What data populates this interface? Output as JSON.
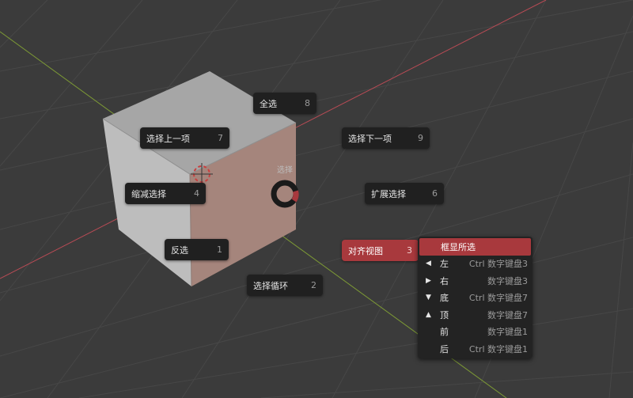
{
  "pie": {
    "center_label": "选择",
    "items": [
      {
        "label": "全选",
        "key": "8"
      },
      {
        "label": "选择上一项",
        "key": "7"
      },
      {
        "label": "选择下一项",
        "key": "9"
      },
      {
        "label": "缩减选择",
        "key": "4"
      },
      {
        "label": "扩展选择",
        "key": "6"
      },
      {
        "label": "反选",
        "key": "1"
      },
      {
        "label": "对齐视图",
        "key": "3"
      },
      {
        "label": "选择循环",
        "key": "2"
      }
    ]
  },
  "submenu": {
    "items": [
      {
        "label": "框显所选",
        "icon": "none",
        "shortcut": ""
      },
      {
        "label": "左",
        "icon": "triangle-left-icon",
        "shortcut": "Ctrl 数字键盘3"
      },
      {
        "label": "右",
        "icon": "triangle-right-icon",
        "shortcut": "数字键盘3"
      },
      {
        "label": "底",
        "icon": "triangle-down-icon",
        "shortcut": "Ctrl 数字键盘7"
      },
      {
        "label": "顶",
        "icon": "triangle-up-icon",
        "shortcut": "数字键盘7"
      },
      {
        "label": "前",
        "icon": "none",
        "shortcut": "数字键盘1"
      },
      {
        "label": "后",
        "icon": "none",
        "shortcut": "Ctrl 数字键盘1"
      }
    ]
  },
  "colors": {
    "background": "#3b3b3b",
    "grid": "#4a4a4a",
    "x_axis": "#b84b55",
    "y_axis": "#7d9a35",
    "active": "#a8393d",
    "button": "#202020"
  }
}
